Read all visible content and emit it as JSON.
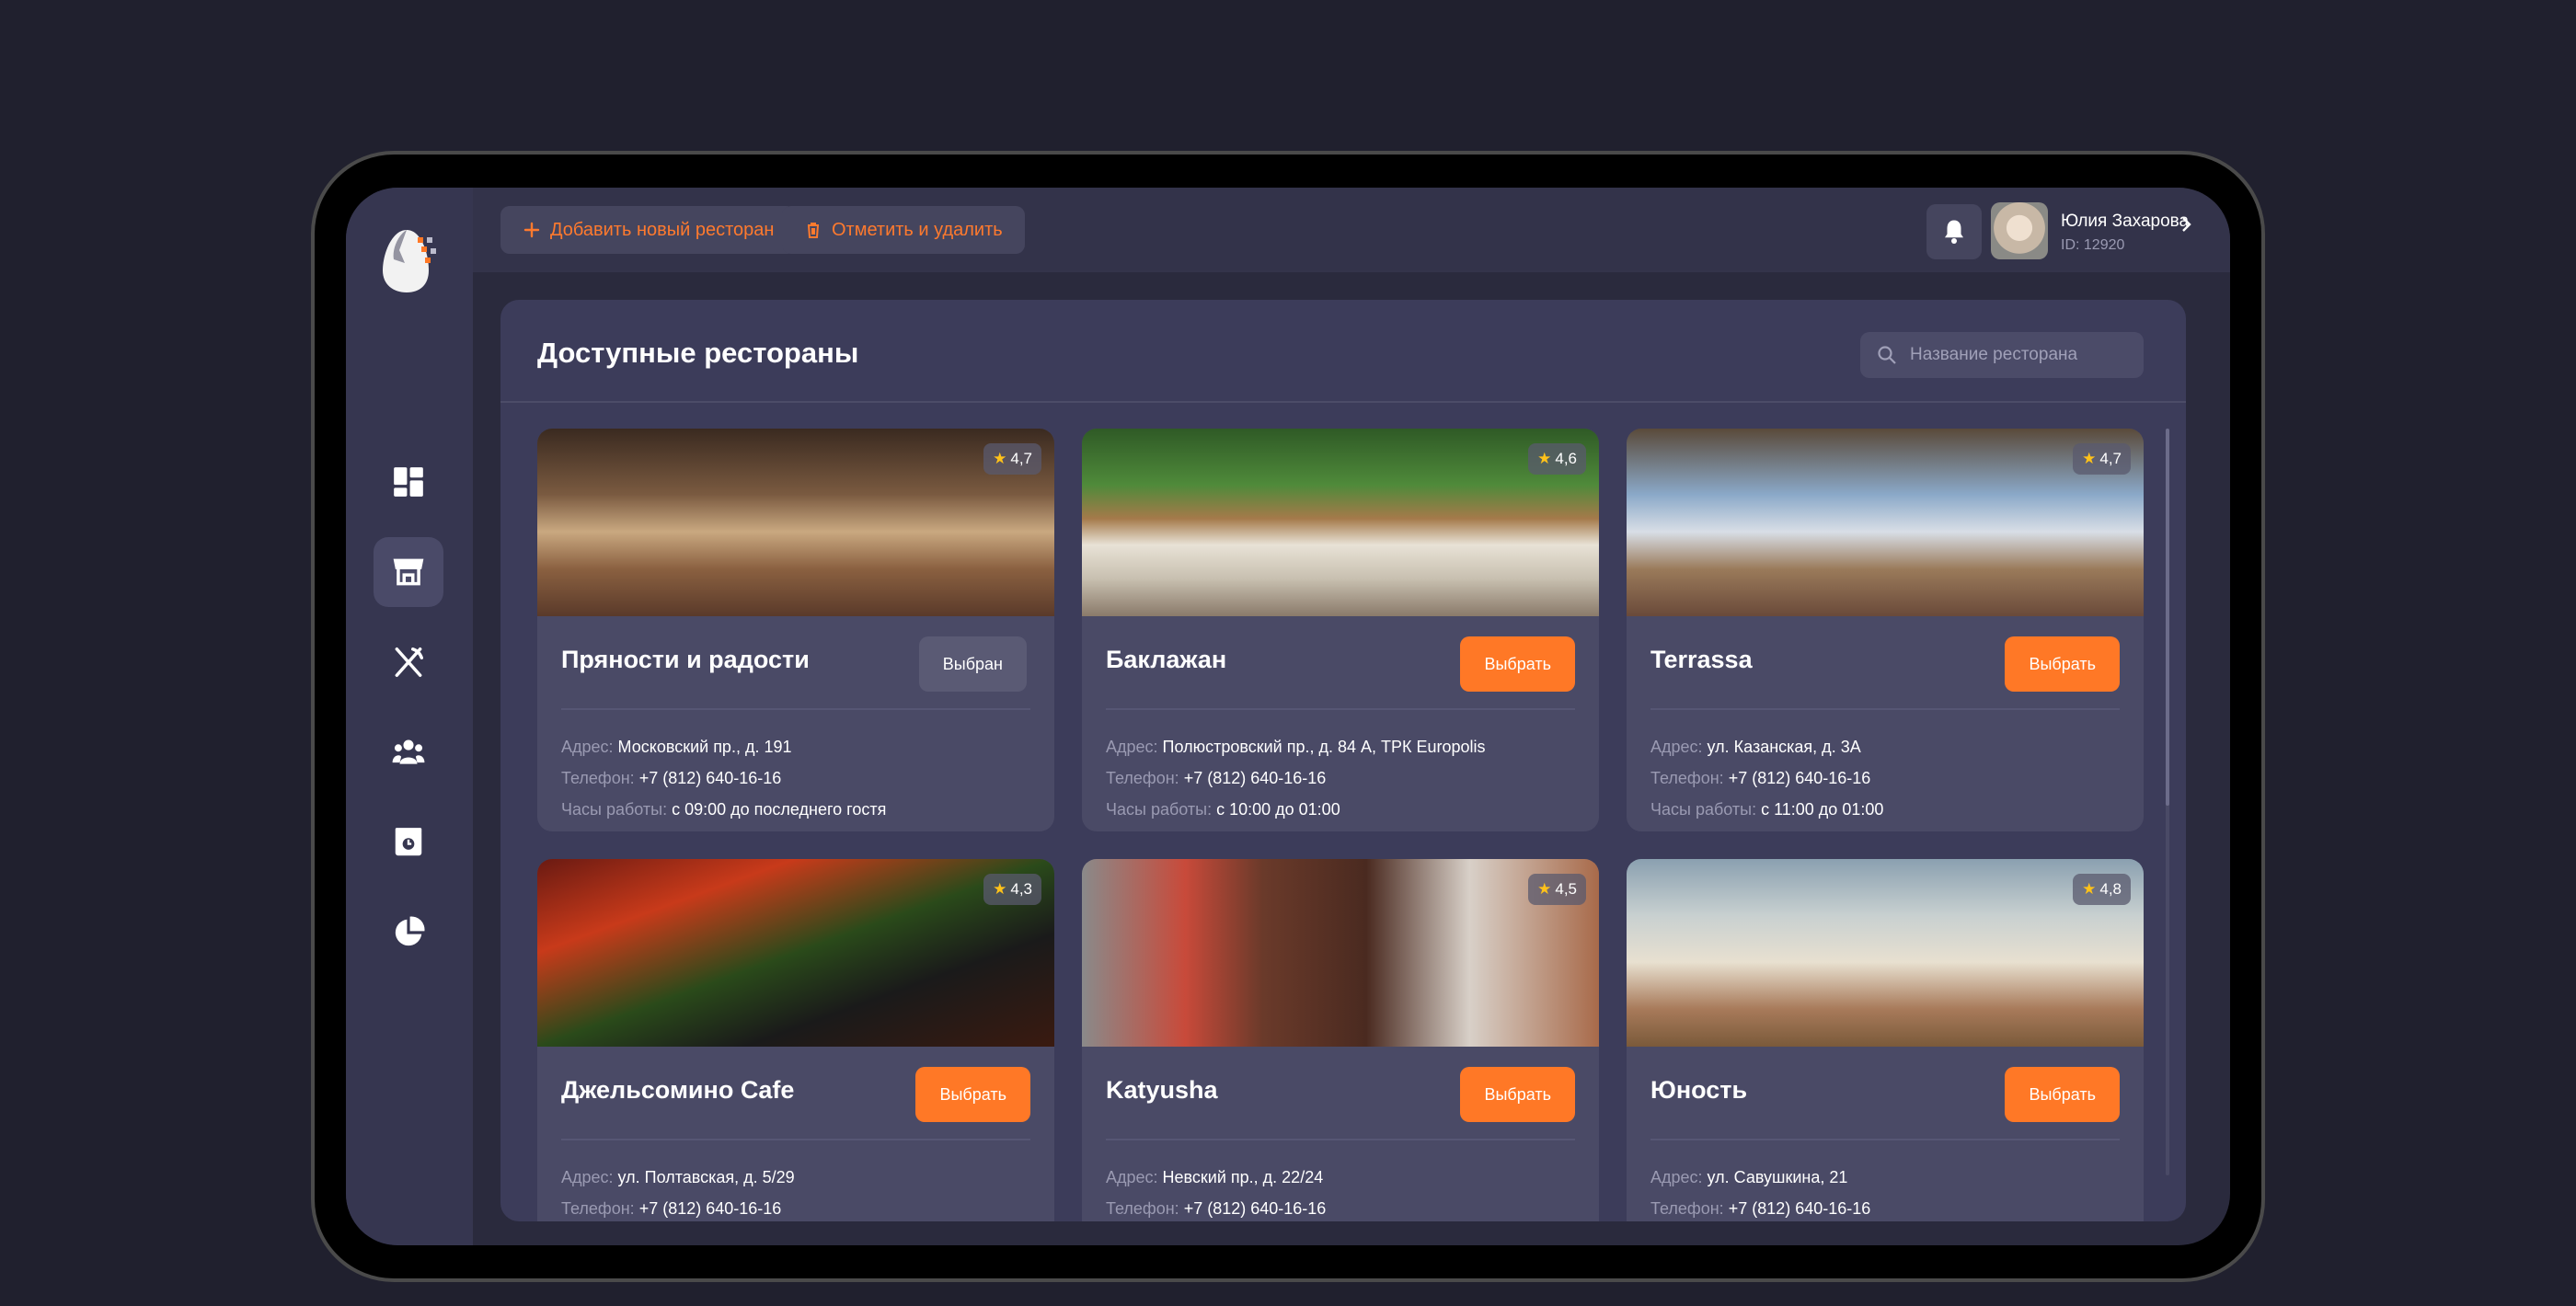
{
  "topbar": {
    "add_label": "Добавить новый ресторан",
    "delete_label": "Отметить и удалить",
    "user": {
      "name": "Юлия Захарова",
      "id": "ID: 12920"
    }
  },
  "panel": {
    "title": "Доступные рестораны",
    "search_placeholder": "Название ресторана"
  },
  "labels": {
    "address": "Адрес:",
    "phone": "Телефон:",
    "hours": "Часы работы:"
  },
  "colors": {
    "accent": "#ff7826",
    "star": "#ffc21a",
    "background": "#2a2a3d",
    "card": "#4a4a66"
  },
  "sidebar": {
    "items": [
      {
        "icon": "dashboard-icon",
        "active": false
      },
      {
        "icon": "store-icon",
        "active": true
      },
      {
        "icon": "cutlery-icon",
        "active": false
      },
      {
        "icon": "users-icon",
        "active": false
      },
      {
        "icon": "box-icon",
        "active": false
      },
      {
        "icon": "pie-chart-icon",
        "active": false
      }
    ]
  },
  "restaurants": [
    {
      "name": "Пряности и радости",
      "rating": "4,7",
      "button": "Выбран",
      "selected": true,
      "address": "Московский пр., д. 191",
      "phone": "+7 (812) 640-16-16",
      "hours": "с 09:00 до последнего гостя"
    },
    {
      "name": "Баклажан",
      "rating": "4,6",
      "button": "Выбрать",
      "selected": false,
      "address": "Полюстровский пр., д. 84 А, ТРК Europolis",
      "phone": "+7 (812) 640-16-16",
      "hours": "с 10:00 до 01:00"
    },
    {
      "name": "Terrassa",
      "rating": "4,7",
      "button": "Выбрать",
      "selected": false,
      "address": "ул. Казанская, д. 3А",
      "phone": "+7 (812) 640-16-16",
      "hours": "с 11:00 до 01:00"
    },
    {
      "name": "Джельсомино Cafe",
      "rating": "4,3",
      "button": "Выбрать",
      "selected": false,
      "address": "ул. Полтавская, д. 5/29",
      "phone": "+7 (812) 640-16-16",
      "hours": ""
    },
    {
      "name": "Katyusha",
      "rating": "4,5",
      "button": "Выбрать",
      "selected": false,
      "address": "Невский пр., д. 22/24",
      "phone": "+7 (812) 640-16-16",
      "hours": ""
    },
    {
      "name": "Юность",
      "rating": "4,8",
      "button": "Выбрать",
      "selected": false,
      "address": "ул. Савушкина, 21",
      "phone": "+7 (812) 640-16-16",
      "hours": ""
    }
  ]
}
